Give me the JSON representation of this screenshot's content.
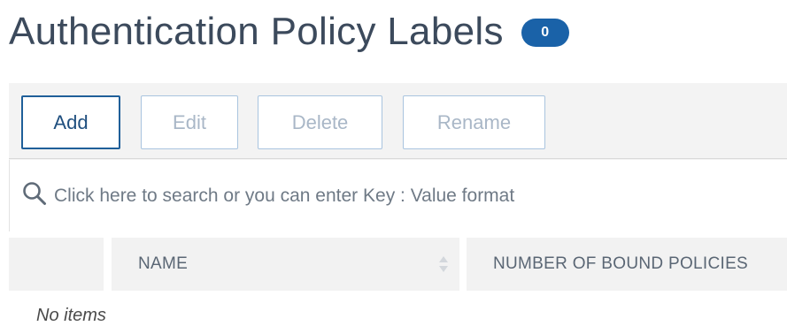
{
  "header": {
    "title": "Authentication Policy Labels",
    "count": "0"
  },
  "toolbar": {
    "add_label": "Add",
    "edit_label": "Edit",
    "delete_label": "Delete",
    "rename_label": "Rename"
  },
  "search": {
    "icon": "search-icon",
    "placeholder": "Click here to search or you can enter Key : Value format"
  },
  "table": {
    "columns": [
      "NAME",
      "NUMBER OF BOUND POLICIES"
    ],
    "empty_message": "No items"
  },
  "colors": {
    "badge": "#1a62a8",
    "primary_border": "#1f5f99",
    "title": "#3c4a5c"
  }
}
